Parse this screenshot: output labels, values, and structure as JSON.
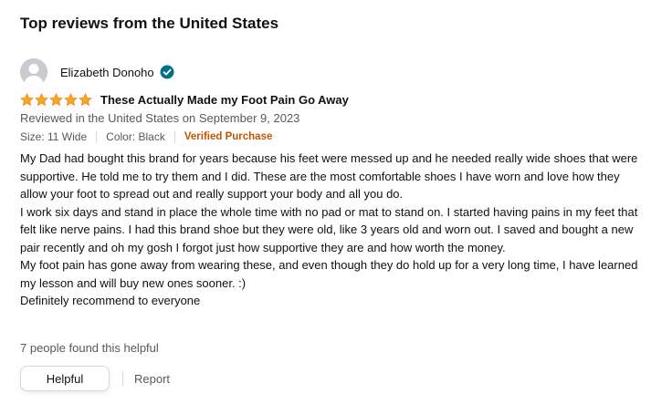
{
  "section": {
    "heading": "Top reviews from the United States"
  },
  "review": {
    "reviewer_name": "Elizabeth Donoho",
    "avatar_icon": "user-avatar-icon",
    "verified_icon": "check-circle-icon",
    "rating": 5,
    "rating_max": 5,
    "title": "These Actually Made my Foot Pain Go Away",
    "date_text": "Reviewed in the United States on September 9, 2023",
    "size_text": "Size: 11 Wide",
    "color_text": "Color: Black",
    "verified_label": "Verified Purchase",
    "paragraphs": [
      "My Dad had bought this brand for years because his feet were messed up and he needed really wide shoes that were supportive. He told me to try them and I did. These are the most comfortable shoes I have worn and love how they allow your foot to spread out and really support your body and all you do.",
      "I work six days and stand in place the whole time with no pad or mat to stand on. I started having pains in my feet that felt like nerve pains. I had this brand shoe but they were old, like 3 years old and worn out. I saved and bought a new pair recently and oh my gosh I forgot just how supportive they are and how worth the money.",
      "My foot pain has gone away from wearing these, and even though they do hold up for a very long time, I have learned my lesson and will buy new ones sooner. :)",
      "Definitely recommend to everyone"
    ],
    "helpful_count_text": "7 people found this helpful",
    "helpful_button": "Helpful",
    "report_link": "Report"
  },
  "colors": {
    "star": "#FFA41C",
    "verified": "#C45500",
    "muted_text": "#565959",
    "check_badge": "#007185"
  }
}
